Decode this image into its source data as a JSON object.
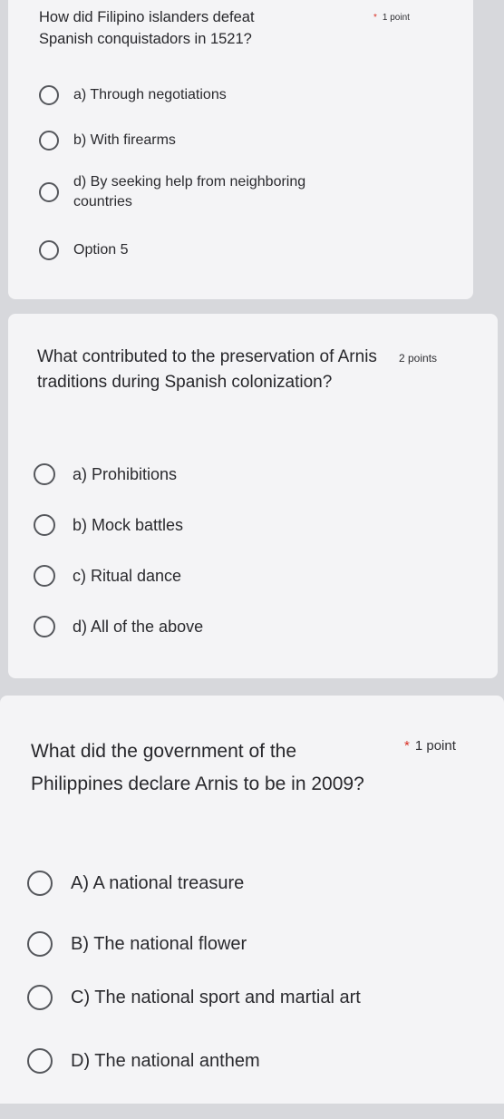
{
  "questions": [
    {
      "text": "How did Filipino islanders defeat Spanish conquistadors in 1521?",
      "required": true,
      "required_mark": "*",
      "points": "1 point",
      "options": [
        "a) Through negotiations",
        "b) With firearms",
        "d) By seeking help from neighboring countries",
        "Option 5"
      ]
    },
    {
      "text": "What contributed to the preservation of Arnis traditions during Spanish colonization?",
      "required": false,
      "points": "2 points",
      "options": [
        "a) Prohibitions",
        "b) Mock battles",
        "c) Ritual dance",
        "d) All of the above"
      ]
    },
    {
      "text": "What did the government of the Philippines declare Arnis to be in 2009?",
      "required": true,
      "required_mark": "*",
      "points": "1 point",
      "options": [
        "A) A national treasure",
        "B) The national flower",
        "C) The national sport and martial art",
        "D) The national anthem"
      ]
    }
  ],
  "colors": {
    "background": "#d7d8dc",
    "card": "#f4f4f6",
    "required_star": "#d93025",
    "radio_border": "#55575c"
  }
}
